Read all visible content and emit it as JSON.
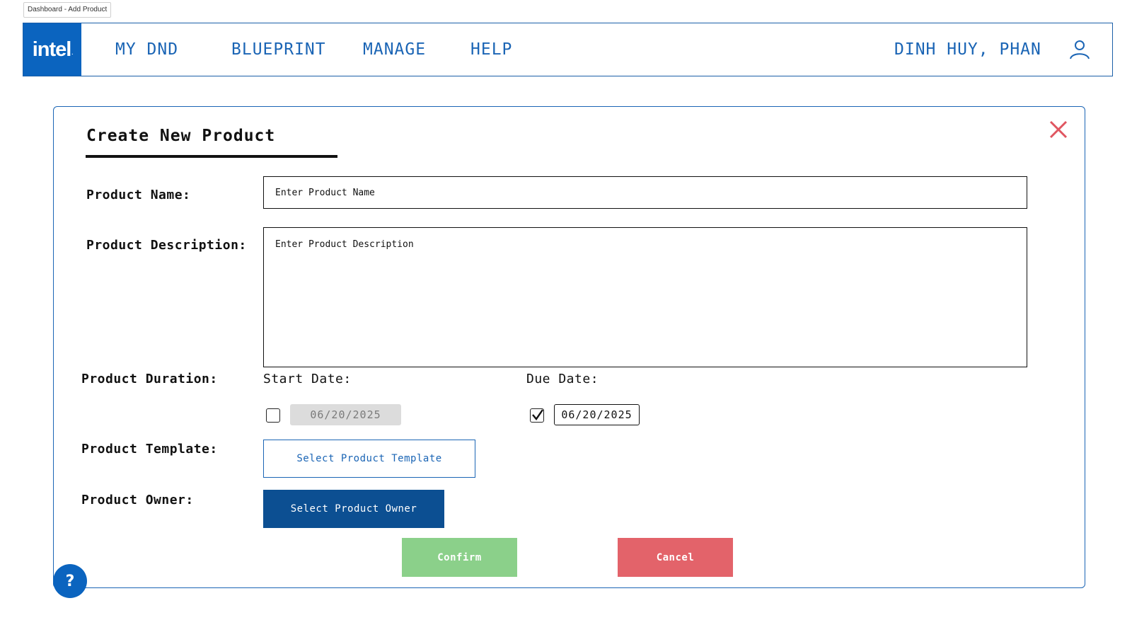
{
  "tab": {
    "title": "Dashboard - Add Product"
  },
  "navbar": {
    "logo_text": "intel",
    "items": [
      {
        "label": "MY DND"
      },
      {
        "label": "BLUEPRINT"
      },
      {
        "label": "MANAGE"
      },
      {
        "label": "HELP"
      }
    ],
    "user_name": "DINH HUY, PHAN",
    "user_icon": "user-icon"
  },
  "modal": {
    "title": "Create New Product",
    "close_icon": "close-icon",
    "product_name": {
      "label": "Product Name:",
      "placeholder": "Enter Product Name",
      "value": ""
    },
    "product_description": {
      "label": "Product Description:",
      "placeholder": "Enter Product Description",
      "value": ""
    },
    "product_duration": {
      "label": "Product Duration:",
      "start_date": {
        "label": "Start Date:",
        "checked": false,
        "value": "06/20/2025"
      },
      "due_date": {
        "label": "Due Date:",
        "checked": true,
        "value": "06/20/2025"
      }
    },
    "product_template": {
      "label": "Product Template:",
      "button": "Select Product Template"
    },
    "product_owner": {
      "label": "Product Owner:",
      "button": "Select Product Owner"
    },
    "confirm_label": "Confirm",
    "cancel_label": "Cancel"
  },
  "help_button": {
    "label": "?"
  },
  "colors": {
    "brand_blue": "#0b64bf",
    "nav_text": "#1b65b5",
    "owner_button": "#0c4f92",
    "confirm": "#8bd08a",
    "cancel": "#e3636a",
    "close_x": "#e05560"
  }
}
